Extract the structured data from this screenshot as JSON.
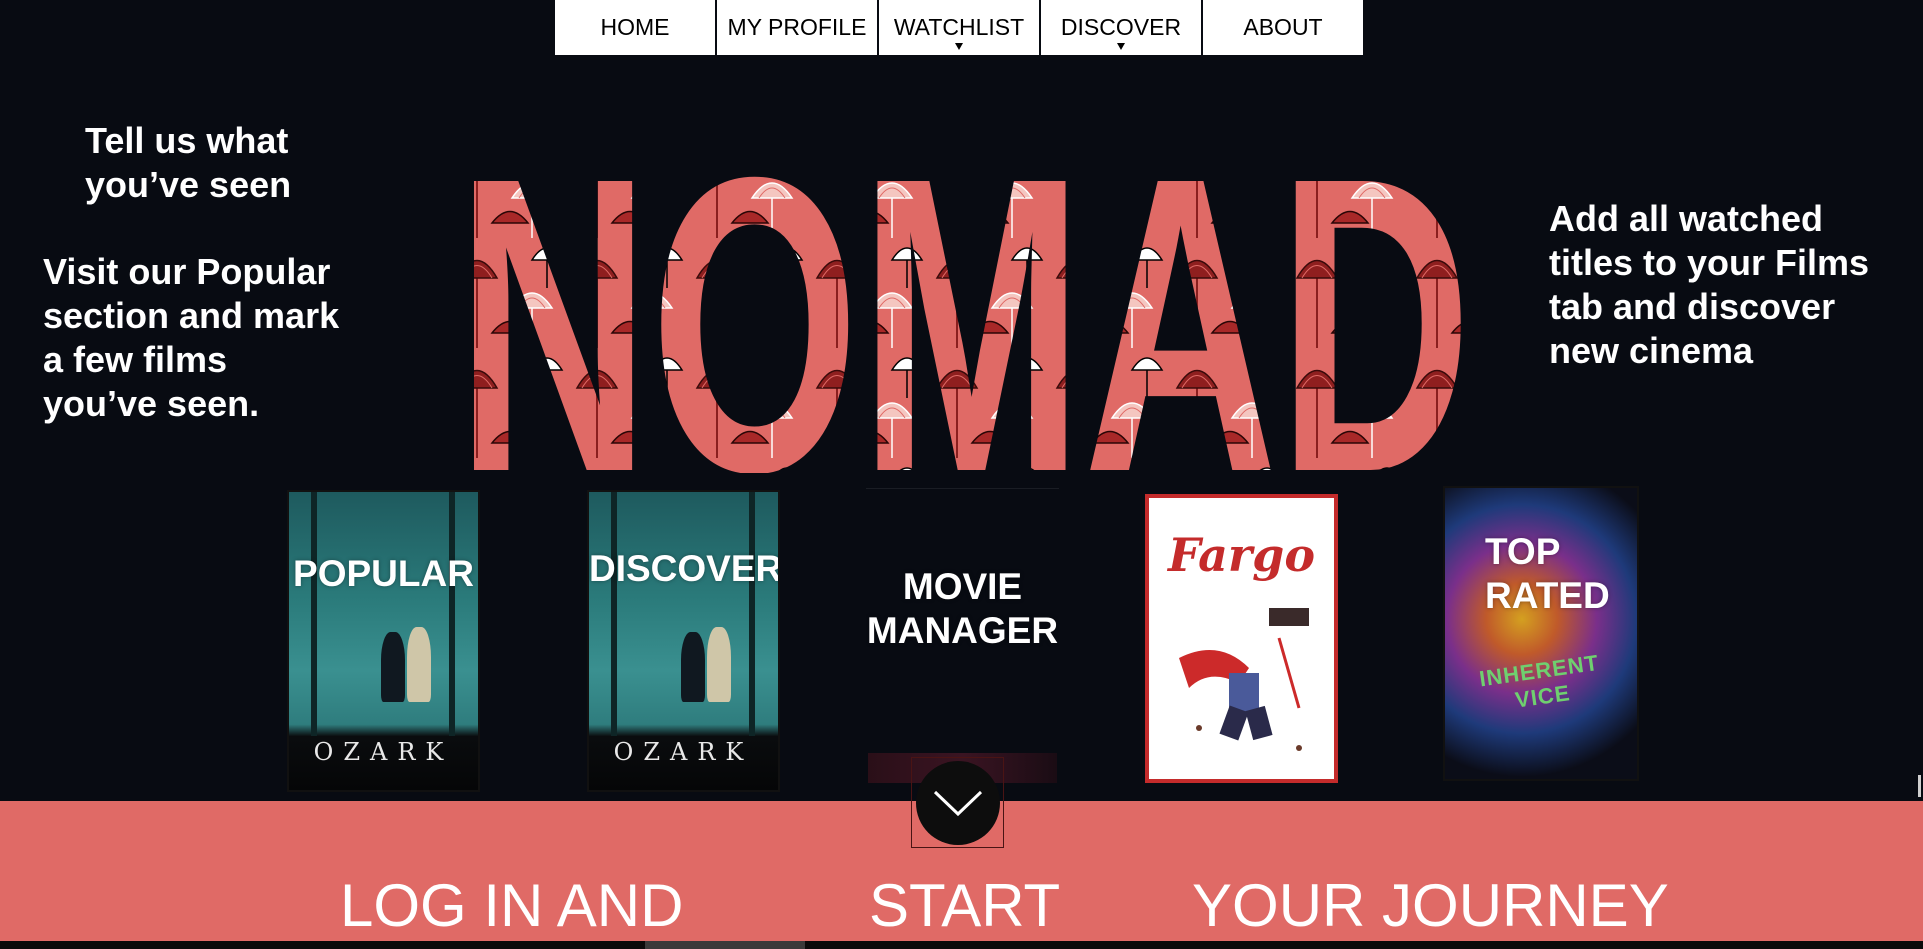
{
  "nav": {
    "items": [
      {
        "label": "HOME",
        "has_caret": false
      },
      {
        "label": "MY PROFILE",
        "has_caret": false
      },
      {
        "label": "WATCHLIST",
        "has_caret": true
      },
      {
        "label": "DISCOVER",
        "has_caret": true
      },
      {
        "label": "ABOUT",
        "has_caret": false
      }
    ]
  },
  "left": {
    "heading": "Tell us what you’ve seen",
    "body": " Visit our Popular\nsection and mark\na few films\nyou’ve seen."
  },
  "right": {
    "body": "Add all watched titles to your Films tab and discover new cinema"
  },
  "hero": {
    "title": "NOMAD",
    "color": "#e06a66"
  },
  "cards": [
    {
      "label": "POPULAR",
      "poster_title": "OZARK"
    },
    {
      "label": "DISCOVER",
      "poster_title": "OZARK"
    },
    {
      "label": "MOVIE\nMANAGER"
    },
    {
      "poster_title": "Fargo"
    },
    {
      "label": "TOP\nRATED",
      "poster_title": "INHERENT VICE"
    }
  ],
  "band": {
    "words": [
      "LOG IN AND",
      "START",
      "YOUR JOURNEY"
    ],
    "color": "#e06a66"
  },
  "scroll_button": {
    "icon": "chevron-down-icon"
  }
}
